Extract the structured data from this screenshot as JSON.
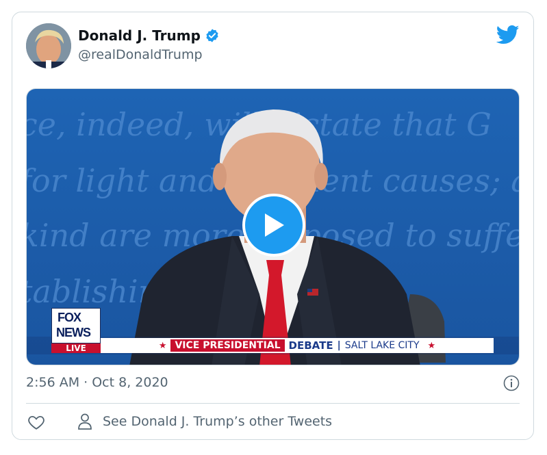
{
  "tweet": {
    "author_name": "Donald J. Trump",
    "handle": "@realDonaldTrump",
    "timestamp": "2:56 AM · Oct 8, 2020",
    "other_tweets_label": "See Donald J. Trump’s other Tweets"
  },
  "video": {
    "background_text": [
      "ce, indeed, will dictate that G",
      "for light and transient causes; a",
      "kind are more disposed to suffer, w",
      "tablishing  ..  such they"
    ],
    "network": {
      "line1": "FOX",
      "line2": "NEWS",
      "live": "LIVE"
    },
    "chyron": {
      "part1": "VICE PRESIDENTIAL",
      "part2": "DEBATE",
      "separator": "|",
      "part3": "SALT LAKE CITY"
    }
  },
  "icons": {
    "verified": "verified-badge-icon",
    "brand": "twitter-bird-icon",
    "play": "play-icon",
    "info": "info-icon",
    "like": "heart-icon",
    "profile": "person-icon"
  },
  "colors": {
    "accent": "#1d9bf0",
    "text": "#0f1419",
    "secondary": "#536471",
    "border": "#cfd9de",
    "chyron_red": "#c8102e",
    "chyron_blue": "#1a3a8a"
  }
}
